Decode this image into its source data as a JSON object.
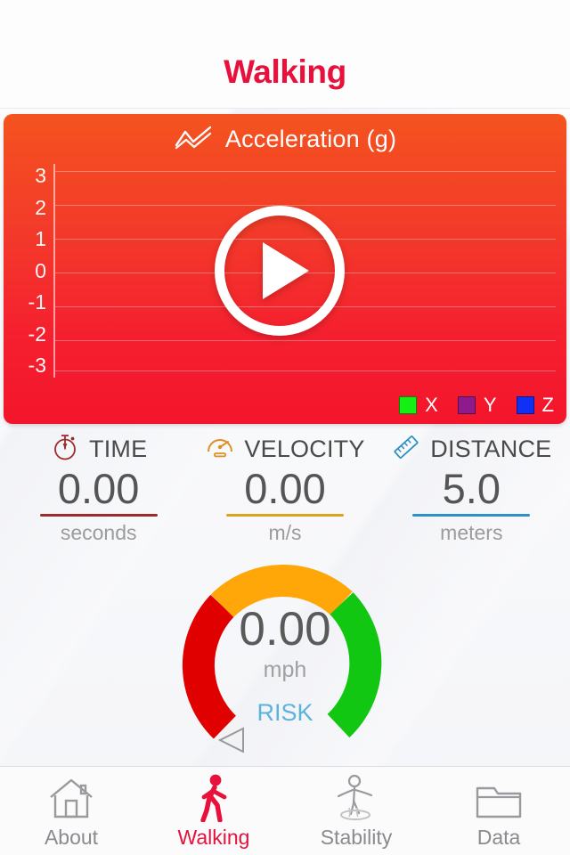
{
  "header": {
    "title": "Walking"
  },
  "chart": {
    "icon": "line-chart-icon",
    "title": "Acceleration (g)",
    "play_button": "play-icon",
    "chart_data": {
      "type": "line",
      "title": "Acceleration (g)",
      "xlabel": "",
      "ylabel": "Acceleration (g)",
      "ylim": [
        -3,
        3
      ],
      "ytick_labels": [
        "3",
        "2",
        "1",
        "0",
        "-1",
        "-2",
        "-3"
      ],
      "yticks": [
        3,
        2,
        1,
        0,
        -1,
        -2,
        -3
      ],
      "grid": true,
      "legend_position": "bottom-right",
      "series": [
        {
          "name": "X",
          "color": "#14F014",
          "values": []
        },
        {
          "name": "Y",
          "color": "#8E1A8E",
          "values": []
        },
        {
          "name": "Z",
          "color": "#1030F5",
          "values": []
        }
      ]
    },
    "legend": [
      {
        "label": "X",
        "color": "#14F014"
      },
      {
        "label": "Y",
        "color": "#8E1A8E"
      },
      {
        "label": "Z",
        "color": "#1030F5"
      }
    ]
  },
  "stats": [
    {
      "icon": "stopwatch-icon",
      "name": "TIME",
      "value": "0.00",
      "unit": "seconds",
      "accent": "#9E2B2B"
    },
    {
      "icon": "speedometer-icon",
      "name": "VELOCITY",
      "value": "0.00",
      "unit": "m/s",
      "accent": "#D8A521"
    },
    {
      "icon": "ruler-icon",
      "name": "DISTANCE",
      "value": "5.0",
      "unit": "meters",
      "accent": "#2E90C4"
    }
  ],
  "gauge": {
    "value": "0.00",
    "unit": "mph",
    "label": "RISK",
    "needle_position_deg": 212,
    "segments": [
      {
        "name": "high",
        "color": "#E00000",
        "start_deg": 205,
        "end_deg": 290
      },
      {
        "name": "medium",
        "color": "#FFA608",
        "start_deg": 290,
        "end_deg": 50
      },
      {
        "name": "low",
        "color": "#12C712",
        "start_deg": 50,
        "end_deg": 140
      }
    ]
  },
  "tabs": [
    {
      "icon": "home-icon",
      "label": "About",
      "active": false
    },
    {
      "icon": "walking-person-icon",
      "label": "Walking",
      "active": true
    },
    {
      "icon": "balance-person-icon",
      "label": "Stability",
      "active": false
    },
    {
      "icon": "folder-icon",
      "label": "Data",
      "active": false
    }
  ]
}
